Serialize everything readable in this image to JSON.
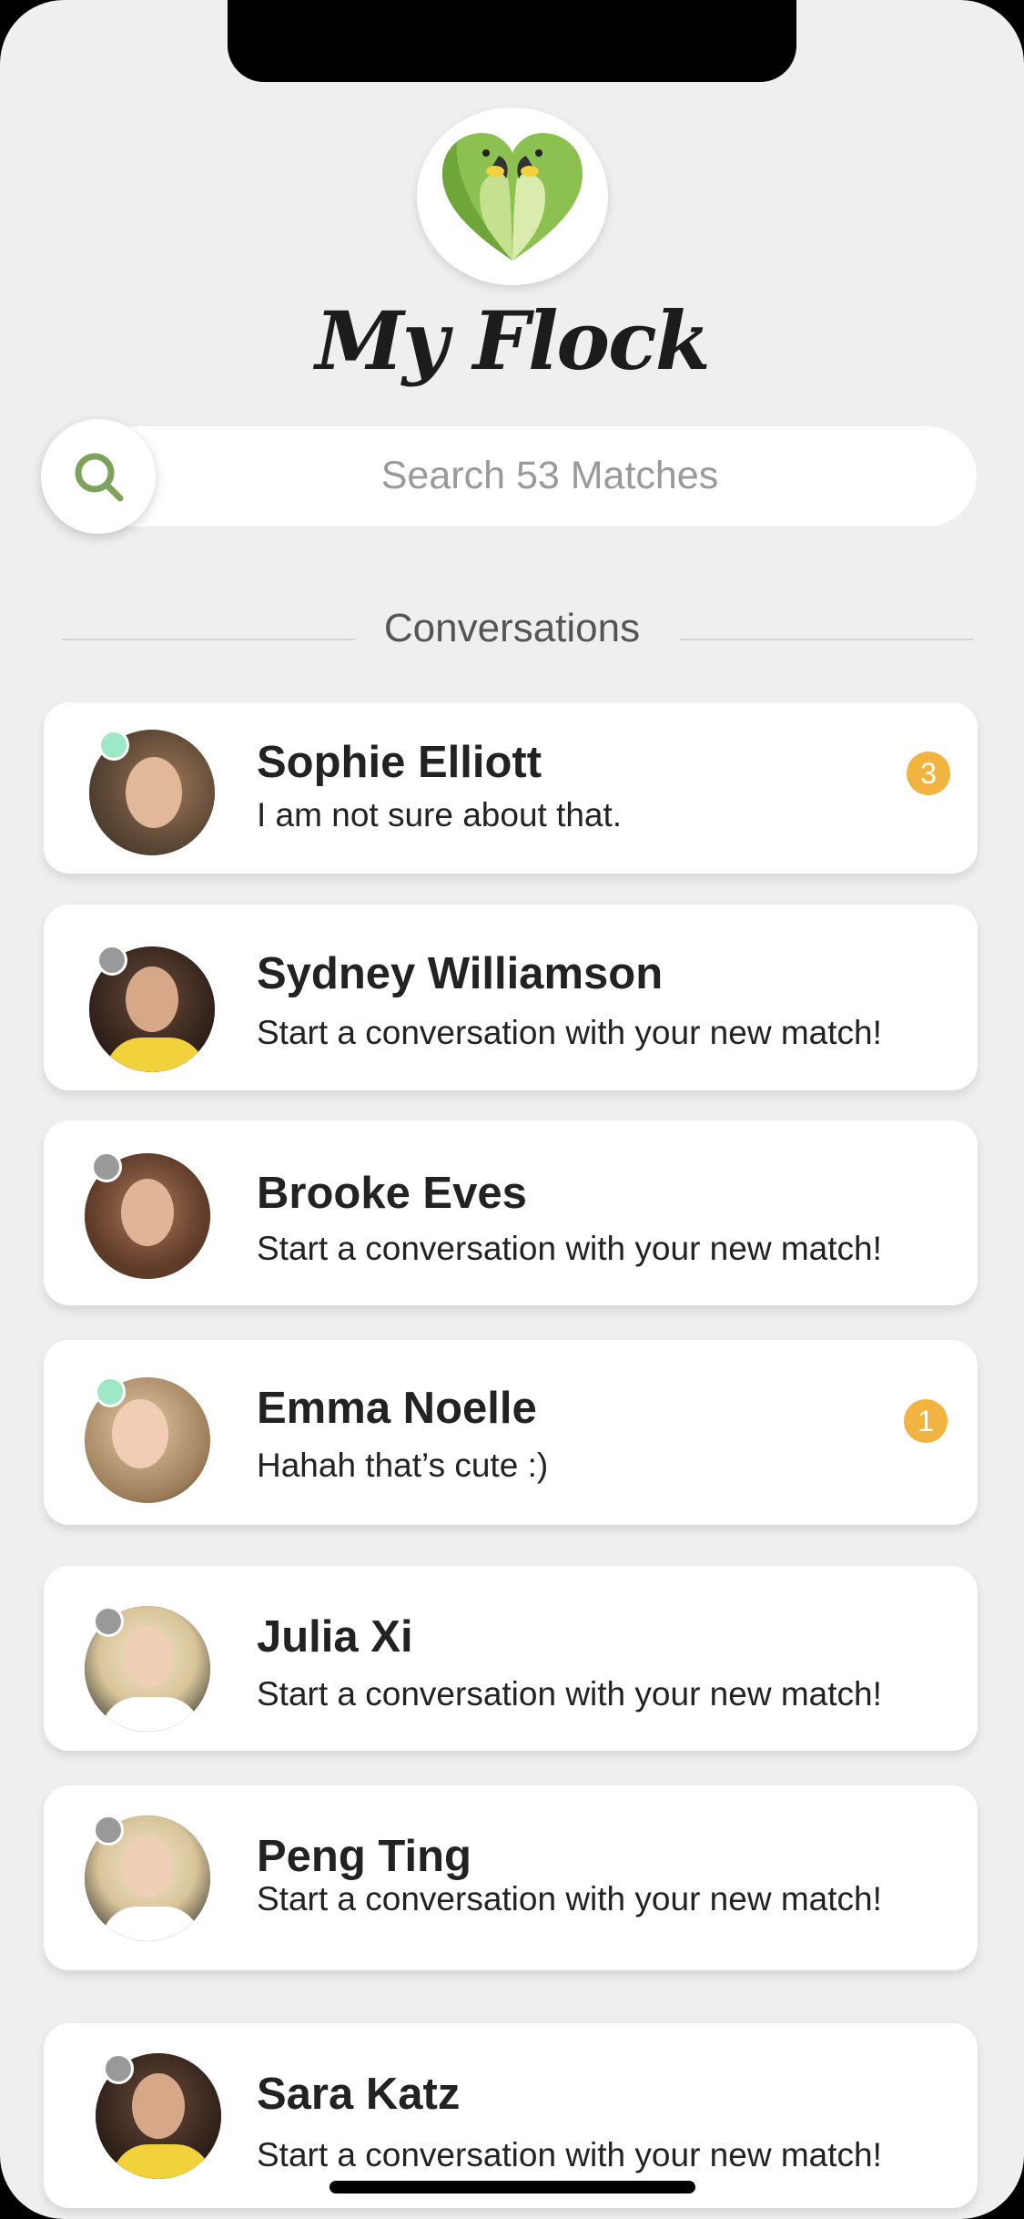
{
  "header": {
    "app_title": "My Flock",
    "logo": "parrot-heart-logo"
  },
  "search": {
    "placeholder": "Search 53 Matches",
    "icon": "search-icon"
  },
  "section": {
    "title": "Conversations"
  },
  "colors": {
    "online": "#9ee8c6",
    "offline": "#999999",
    "badge": "#f2b441",
    "brand_green": "#8cc152"
  },
  "conversations": [
    {
      "name": "Sophie Elliott",
      "message": "I am not sure about that.",
      "status": "online",
      "unread": "3"
    },
    {
      "name": "Sydney Williamson",
      "message": "Start a conversation with your new match!",
      "status": "offline",
      "unread": ""
    },
    {
      "name": "Brooke Eves",
      "message": "Start a conversation with your new match!",
      "status": "offline",
      "unread": ""
    },
    {
      "name": "Emma Noelle",
      "message": "Hahah that’s cute :)",
      "status": "online",
      "unread": "1"
    },
    {
      "name": "Julia Xi",
      "message": "Start a conversation with your new match!",
      "status": "offline",
      "unread": ""
    },
    {
      "name": "Peng Ting",
      "message": "Start a conversation with your new match!",
      "status": "offline",
      "unread": ""
    },
    {
      "name": "Sara Katz",
      "message": "Start a conversation with your new match!",
      "status": "offline",
      "unread": ""
    }
  ]
}
